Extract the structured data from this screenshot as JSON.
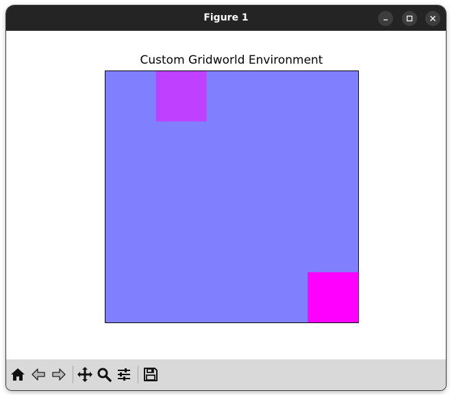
{
  "window": {
    "title": "Figure 1",
    "controls": [
      "minimize-icon",
      "maximize-icon",
      "close-icon"
    ]
  },
  "toolbar": {
    "items": [
      "home-icon",
      "back-arrow-icon",
      "forward-arrow-icon",
      "pan-move-icon",
      "zoom-magnifier-icon",
      "configure-subplots-icon",
      "save-floppy-icon"
    ]
  },
  "colors": {
    "titlebar": "#242424",
    "background_cell": "#8080ff",
    "agent_cell": "#c040ff",
    "goal_cell": "#ff00ff",
    "toolbar": "#d9d9d9"
  },
  "chart_data": {
    "type": "heatmap",
    "title": "Custom Gridworld Environment",
    "grid_size": 5,
    "grid": false,
    "axes_visible": false,
    "cells": [
      {
        "row": 0,
        "col": 1,
        "color": "#c040ff"
      },
      {
        "row": 4,
        "col": 4,
        "color": "#ff00ff"
      }
    ]
  }
}
